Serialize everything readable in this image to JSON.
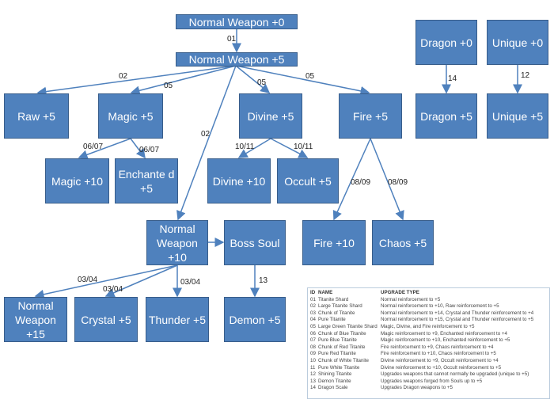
{
  "nodes": {
    "nw0": "Normal Weapon +0",
    "nw5": "Normal Weapon +5",
    "raw5": "Raw +5",
    "magic5": "Magic +5",
    "divine5": "Divine +5",
    "fire5": "Fire +5",
    "dragon0": "Dragon +0",
    "unique0": "Unique +0",
    "dragon5": "Dragon +5",
    "unique5": "Unique +5",
    "magic10": "Magic +10",
    "enchanted5": "Enchante d +5",
    "divine10": "Divine +10",
    "occult5": "Occult +5",
    "fire10": "Fire +10",
    "chaos5": "Chaos +5",
    "nw10": "Normal Weapon +10",
    "bosssoul": "Boss Soul",
    "nw15": "Normal Weapon +15",
    "crystal5": "Crystal +5",
    "thunder5": "Thunder +5",
    "demon5": "Demon +5"
  },
  "edge_labels": {
    "e01": "01",
    "e02a": "02",
    "e05a": "05",
    "e05b": "05",
    "e05c": "05",
    "e02b": "02",
    "e14": "14",
    "e12": "12",
    "e0607a": "06/07",
    "e0607b": "06/07",
    "e1011a": "10/11",
    "e1011b": "10/11",
    "e0809a": "08/09",
    "e0809b": "08/09",
    "e0304a": "03/04",
    "e0304b": "03/04",
    "e0304c": "03/04",
    "e13": "13"
  },
  "table": {
    "headers": [
      "ID",
      "NAME",
      "UPGRADE TYPE"
    ],
    "rows": [
      [
        "01",
        "Titanite Shard",
        "Normal reinforcement to +5"
      ],
      [
        "02",
        "Large Titanite Shard",
        "Normal reinforcement to +10, Raw reinforcement to +5"
      ],
      [
        "03",
        "Chunk of Titanite",
        "Normal reinforcement to +14, Crystal and Thunder reinforcement to +4"
      ],
      [
        "04",
        "Pure Titanite",
        "Normal reinforcement to +15, Crystal and Thunder reinforcement to +5"
      ],
      [
        "05",
        "Large Green Titanite Shard",
        "Magic, Divine, and Fire reinforcement to +5"
      ],
      [
        "06",
        "Chunk of Blue Titanite",
        "Magic reinforcement to +9, Enchanted reinforcement to +4"
      ],
      [
        "07",
        "Pure Blue Titanite",
        "Magic reinforcement to +10, Enchanted reinforcement to +5"
      ],
      [
        "08",
        "Chunk of Red Titanite",
        "Fire reinforcement to +9, Chaos reinforcement to +4"
      ],
      [
        "09",
        "Pure Red Titanite",
        "Fire reinforcement to +10, Chaos reinforcement to +5"
      ],
      [
        "10",
        "Chunk of White Titanite",
        "Divine reinforcement to +9, Occult reinforcement to +4"
      ],
      [
        "11",
        "Pure White Titanite",
        "Divine reinforcement to +10, Occult reinforcement to +5"
      ],
      [
        "12",
        "Shining Titanite",
        "Upgrades weapons that cannot normally be upgraded (unique to +5)"
      ],
      [
        "13",
        "Demon Titanite",
        "Upgrades weapons forged from Souls up to +5"
      ],
      [
        "14",
        "Dragon Scale",
        "Upgrades Dragon weapons to +5"
      ]
    ]
  },
  "colors": {
    "box": "#4f81bd",
    "border": "#385d8a",
    "arrow": "#4f81bd"
  }
}
